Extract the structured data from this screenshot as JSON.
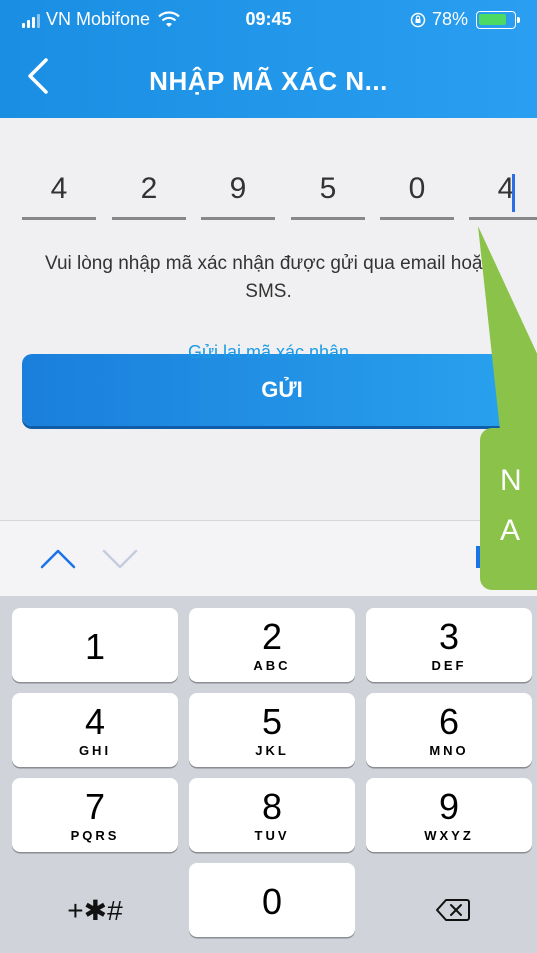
{
  "status": {
    "carrier": "VN Mobifone",
    "time": "09:45",
    "battery": "78%",
    "battery_level": 0.78
  },
  "navbar": {
    "title": "NHẬP MÃ XÁC N..."
  },
  "code": {
    "digits": [
      "4",
      "2",
      "9",
      "5",
      "0",
      "4"
    ]
  },
  "hint": "Vui lòng nhập mã xác nhận được gửi qua email hoặc SMS.",
  "resend_label": "Gửi lại mã xác nhận",
  "send_label": "GỬI",
  "callout": {
    "line1": "N",
    "line2": "A"
  },
  "keypad": {
    "keys": [
      {
        "num": "1",
        "letters": ""
      },
      {
        "num": "2",
        "letters": "ABC"
      },
      {
        "num": "3",
        "letters": "DEF"
      },
      {
        "num": "4",
        "letters": "GHI"
      },
      {
        "num": "5",
        "letters": "JKL"
      },
      {
        "num": "6",
        "letters": "MNO"
      },
      {
        "num": "7",
        "letters": "PQRS"
      },
      {
        "num": "8",
        "letters": "TUV"
      },
      {
        "num": "9",
        "letters": "WXYZ"
      },
      {
        "num": "0",
        "letters": ""
      }
    ],
    "symbols_label": "+✱#"
  },
  "colors": {
    "header": "#1a8ee2",
    "accent": "#1a9be6",
    "callout": "#8bc34a"
  }
}
